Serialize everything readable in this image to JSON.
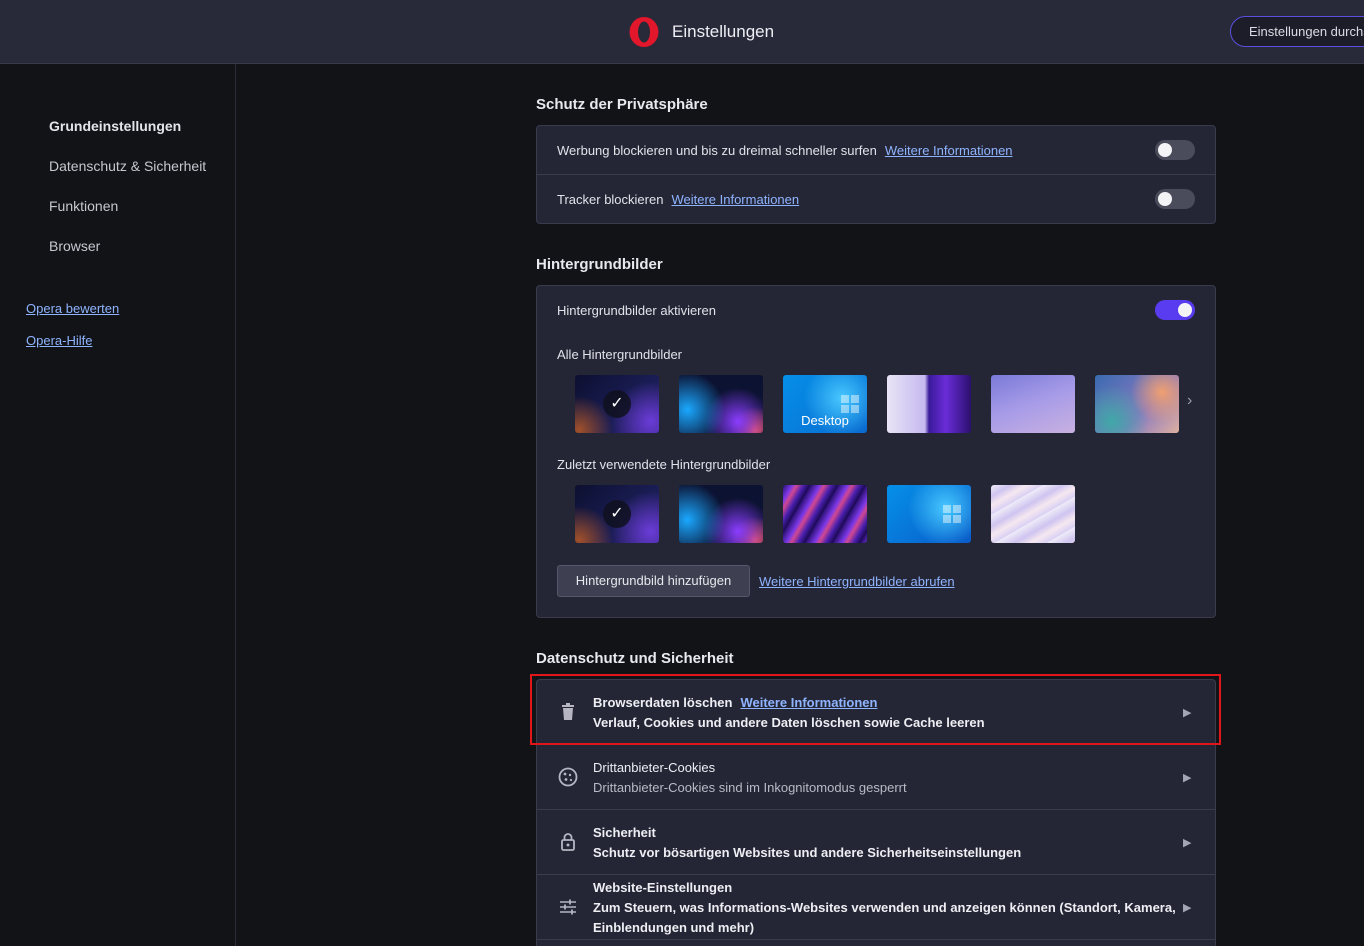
{
  "header": {
    "title": "Einstellungen",
    "search_placeholder": "Einstellungen durchsuchen"
  },
  "sidebar": {
    "items": [
      {
        "label": "Grundeinstellungen"
      },
      {
        "label": "Datenschutz & Sicherheit"
      },
      {
        "label": "Funktionen"
      },
      {
        "label": "Browser"
      }
    ],
    "links": [
      {
        "label": "Opera bewerten"
      },
      {
        "label": "Opera-Hilfe"
      }
    ]
  },
  "privacy_protection": {
    "title": "Schutz der Privatsphäre",
    "rows": [
      {
        "label": "Werbung blockieren und bis zu dreimal schneller surfen",
        "link": "Weitere Informationen",
        "enabled": false
      },
      {
        "label": "Tracker blockieren",
        "link": "Weitere Informationen",
        "enabled": false
      }
    ]
  },
  "wallpapers": {
    "title": "Hintergrundbilder",
    "enable_label": "Hintergrundbilder aktivieren",
    "enabled": true,
    "all_label": "Alle Hintergrundbilder",
    "all": [
      {
        "name": "dark-blue",
        "selected": true
      },
      {
        "name": "blue-purple-glow",
        "selected": false
      },
      {
        "name": "desktop",
        "label": "Desktop",
        "selected": false
      },
      {
        "name": "purple-swirl",
        "selected": false
      },
      {
        "name": "lavender",
        "selected": false
      },
      {
        "name": "teal-orange",
        "selected": false
      }
    ],
    "recent_label": "Zuletzt verwendete Hintergrundbilder",
    "recent": [
      {
        "name": "dark-blue",
        "selected": true
      },
      {
        "name": "blue-purple-glow",
        "selected": false
      },
      {
        "name": "purple-swirl",
        "selected": false
      },
      {
        "name": "windows-blue",
        "selected": false
      },
      {
        "name": "pastel-wave",
        "selected": false
      }
    ],
    "add_button": "Hintergrundbild hinzufügen",
    "more_link": "Weitere Hintergrundbilder abrufen"
  },
  "privacy_security": {
    "title": "Datenschutz und Sicherheit",
    "rows": [
      {
        "icon": "trash-icon",
        "title": "Browserdaten löschen",
        "link": "Weitere Informationen",
        "subtitle": "Verlauf, Cookies und andere Daten löschen sowie Cache leeren"
      },
      {
        "icon": "cookie-icon",
        "title": "Drittanbieter-Cookies",
        "subtitle": "Drittanbieter-Cookies sind im Inkognitomodus gesperrt"
      },
      {
        "icon": "lock-icon",
        "title": "Sicherheit",
        "subtitle": "Schutz vor bösartigen Websites und andere Sicherheitseinstellungen"
      },
      {
        "icon": "sliders-icon",
        "title": "Website-Einstellungen",
        "subtitle_line1": "Zum Steuern, was Informations-Websites verwenden und anzeigen können (Standort, Kamera,",
        "subtitle_line2": "Einblendungen und mehr)"
      }
    ]
  },
  "colors": {
    "accent": "#5a3cf0",
    "link": "#8fb4ff",
    "highlight": "#e0161a",
    "opera_red": "#e3172b"
  }
}
